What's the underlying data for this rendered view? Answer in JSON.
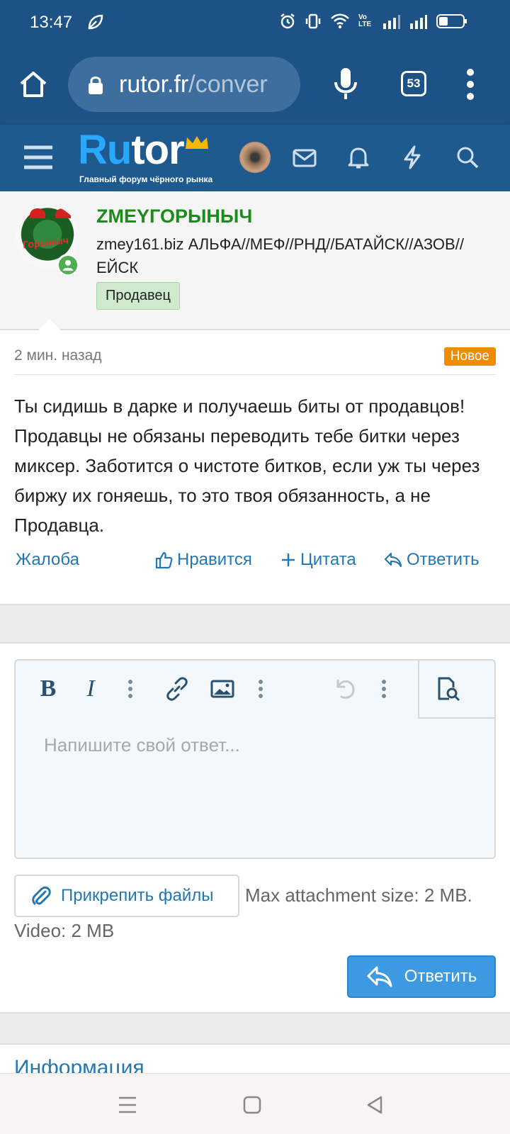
{
  "status_bar": {
    "time": "13:47",
    "icons": [
      "leaf-icon",
      "alarm-icon",
      "vibrate-icon",
      "wifi-icon",
      "volte-icon",
      "signal-icon",
      "signal-icon",
      "battery-icon"
    ],
    "volte_label": "Vo LTE"
  },
  "browser": {
    "url_host": "rutor.fr",
    "url_path": "/conver",
    "tab_count": "53"
  },
  "site": {
    "logo_word_part1": "Ru",
    "logo_word_part2": "t",
    "logo_word_part3": "or",
    "tagline": "Главный форум чёрного рынка",
    "brand_color": "#28a9ff",
    "header_color": "#1f5a8f"
  },
  "post": {
    "username": "ZMEYГОРЫНЫЧ",
    "user_title": "zmey161.biz АЛЬФА//МЕФ//РНД//БАТАЙСК//АЗОВ//ЕЙСК",
    "user_badge": "Продавец",
    "avatar_text": "Горыныч",
    "time_ago": "2 мин. назад",
    "new_label": "Новое",
    "message": "Ты сидишь в дарке и получаешь биты от продавцов! Продавцы не обязаны переводить тебе битки через миксер. Заботится о чистоте битков, если уж ты через биржу их гоняешь, то это твоя обязанность, а не Продавца.",
    "actions": {
      "report": "Жалоба",
      "like": "Нравится",
      "quote": "Цитата",
      "reply": "Ответить"
    }
  },
  "reply_form": {
    "placeholder": "Напишите свой ответ...",
    "attach_label": "Прикрепить файлы",
    "max_size_text": "Max attachment size: 2 MB. Video: 2 MB",
    "submit_label": "Ответить",
    "toolbar": [
      "bold-icon",
      "italic-icon",
      "more-icon",
      "link-icon",
      "image-icon",
      "more-icon",
      "undo-icon",
      "more-icon",
      "preview-icon"
    ]
  },
  "footer": {
    "info_heading": "Информация"
  }
}
